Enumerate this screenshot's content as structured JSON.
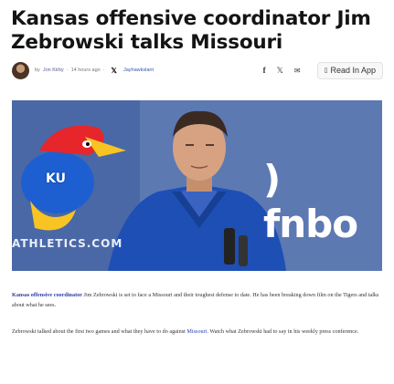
{
  "article": {
    "headline": "Kansas offensive coordinator Jim Zebrowski talks Missouri",
    "byline": {
      "by": "by",
      "author": "Jon Kirby",
      "time": "14 hours ago",
      "x_handle": "Jayhawkslant"
    },
    "share": {
      "read_in_app": "Read In App"
    },
    "image": {
      "brand_text": ") fnbo",
      "site_text": "ATHLETICS.COM",
      "mascot_text": "KU"
    },
    "paragraphs": [
      {
        "lead_link": "Kansas offensive coordinator",
        "text": " Jim Zebrowski is set to face a Missouri and their toughest defense to date. He has been breaking down film on the Tigers and talks about what he sees."
      },
      {
        "text_before": "Zebrowski talked about the first two games and what they have to do against ",
        "link": "Missouri",
        "text_after": ". Watch what Zebrowski had to say in his weekly press conference."
      }
    ]
  },
  "icons": {
    "x": "x-logo-icon",
    "facebook": "facebook-icon",
    "mail": "mail-icon",
    "app": "app-icon"
  },
  "colors": {
    "link": "#2e3fa6",
    "photo_blue": "#4f6aa3",
    "jacket_blue": "#1e4fb5"
  }
}
